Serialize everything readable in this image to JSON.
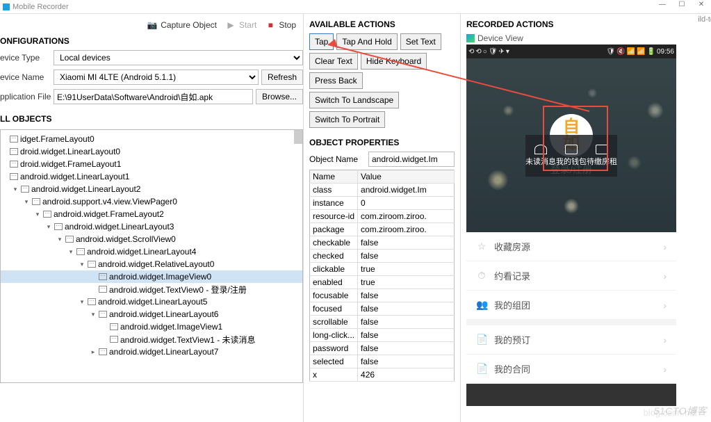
{
  "window": {
    "title": "Mobile Recorder",
    "btns": [
      "—",
      "☐",
      "✕"
    ]
  },
  "ext_text": "ild-to",
  "toolbar": {
    "capture": "Capture Object",
    "start": "Start",
    "stop": "Stop"
  },
  "config": {
    "title": "ONFIGURATIONS",
    "device_type": {
      "label": "evice Type",
      "value": "Local devices"
    },
    "device_name": {
      "label": "evice Name",
      "value": "Xiaomi MI 4LTE (Android 5.1.1)",
      "refresh": "Refresh"
    },
    "app_file": {
      "label": "pplication File",
      "value": "E:\\91UserData\\Software\\Android\\自如.apk",
      "browse": "Browse..."
    }
  },
  "objects": {
    "title": "LL OBJECTS",
    "tree": [
      {
        "i": 0,
        "t": "",
        "ic": 0,
        "l": "idget.FrameLayout0"
      },
      {
        "i": 0,
        "t": "",
        "ic": 1,
        "l": "droid.widget.LinearLayout0"
      },
      {
        "i": 0,
        "t": "",
        "ic": 1,
        "l": "droid.widget.FrameLayout1"
      },
      {
        "i": 0,
        "t": "",
        "ic": 1,
        "l": "android.widget.LinearLayout1"
      },
      {
        "i": 1,
        "t": "▾",
        "ic": 1,
        "l": "android.widget.LinearLayout2"
      },
      {
        "i": 2,
        "t": "▾",
        "ic": 1,
        "l": "android.support.v4.view.ViewPager0"
      },
      {
        "i": 3,
        "t": "▾",
        "ic": 1,
        "l": "android.widget.FrameLayout2"
      },
      {
        "i": 4,
        "t": "▾",
        "ic": 1,
        "l": "android.widget.LinearLayout3"
      },
      {
        "i": 5,
        "t": "▾",
        "ic": 1,
        "l": "android.widget.ScrollView0"
      },
      {
        "i": 6,
        "t": "▾",
        "ic": 1,
        "l": "android.widget.LinearLayout4"
      },
      {
        "i": 7,
        "t": "▾",
        "ic": 1,
        "l": "android.widget.RelativeLayout0"
      },
      {
        "i": 8,
        "t": "",
        "ic": 1,
        "l": "android.widget.ImageView0",
        "sel": true
      },
      {
        "i": 8,
        "t": "",
        "ic": 1,
        "l": "android.widget.TextView0 - 登录/注册"
      },
      {
        "i": 7,
        "t": "▾",
        "ic": 1,
        "l": "android.widget.LinearLayout5"
      },
      {
        "i": 8,
        "t": "▾",
        "ic": 1,
        "l": "android.widget.LinearLayout6"
      },
      {
        "i": 9,
        "t": "",
        "ic": 1,
        "l": "android.widget.ImageView1"
      },
      {
        "i": 9,
        "t": "",
        "ic": 1,
        "l": "android.widget.TextView1 - 未读消息"
      },
      {
        "i": 8,
        "t": "▸",
        "ic": 1,
        "l": "android.widget.LinearLayout7"
      }
    ]
  },
  "actions": {
    "title": "AVAILABLE ACTIONS",
    "items": [
      "Tap",
      "Tap And Hold",
      "Set Text",
      "Clear Text",
      "Hide Keyboard",
      "Press Back",
      "Switch To Landscape",
      "Switch To Portrait"
    ]
  },
  "props": {
    "title": "OBJECT PROPERTIES",
    "name_label": "Object Name",
    "name_value": "android.widget.Im",
    "headers": [
      "Name",
      "Value"
    ],
    "rows": [
      [
        "class",
        "android.widget.Im"
      ],
      [
        "instance",
        "0"
      ],
      [
        "resource-id",
        "com.ziroom.ziroo."
      ],
      [
        "package",
        "com.ziroom.ziroo."
      ],
      [
        "checkable",
        "false"
      ],
      [
        "checked",
        "false"
      ],
      [
        "clickable",
        "true"
      ],
      [
        "enabled",
        "true"
      ],
      [
        "focusable",
        "false"
      ],
      [
        "focused",
        "false"
      ],
      [
        "scrollable",
        "false"
      ],
      [
        "long-click...",
        "false"
      ],
      [
        "password",
        "false"
      ],
      [
        "selected",
        "false"
      ],
      [
        "x",
        "426"
      ]
    ]
  },
  "recorded": {
    "title": "RECORDED ACTIONS",
    "device_view": "Device View"
  },
  "phone": {
    "status_time": "09:56",
    "logo1": "自",
    "logo2": "如",
    "login": "登录/注册",
    "three": [
      "未读消息",
      "我的钱包",
      "待缴房租"
    ],
    "menu": [
      {
        "i": "☆",
        "l": "收藏房源"
      },
      {
        "i": "⏱",
        "l": "约看记录"
      },
      {
        "i": "👥",
        "l": "我的组团"
      }
    ],
    "menu2": [
      {
        "i": "📄",
        "l": "我的预订"
      },
      {
        "i": "📄",
        "l": "我的合同"
      }
    ]
  },
  "watermark": "51CTO博客",
  "watermark2": "blog.csdn.net"
}
